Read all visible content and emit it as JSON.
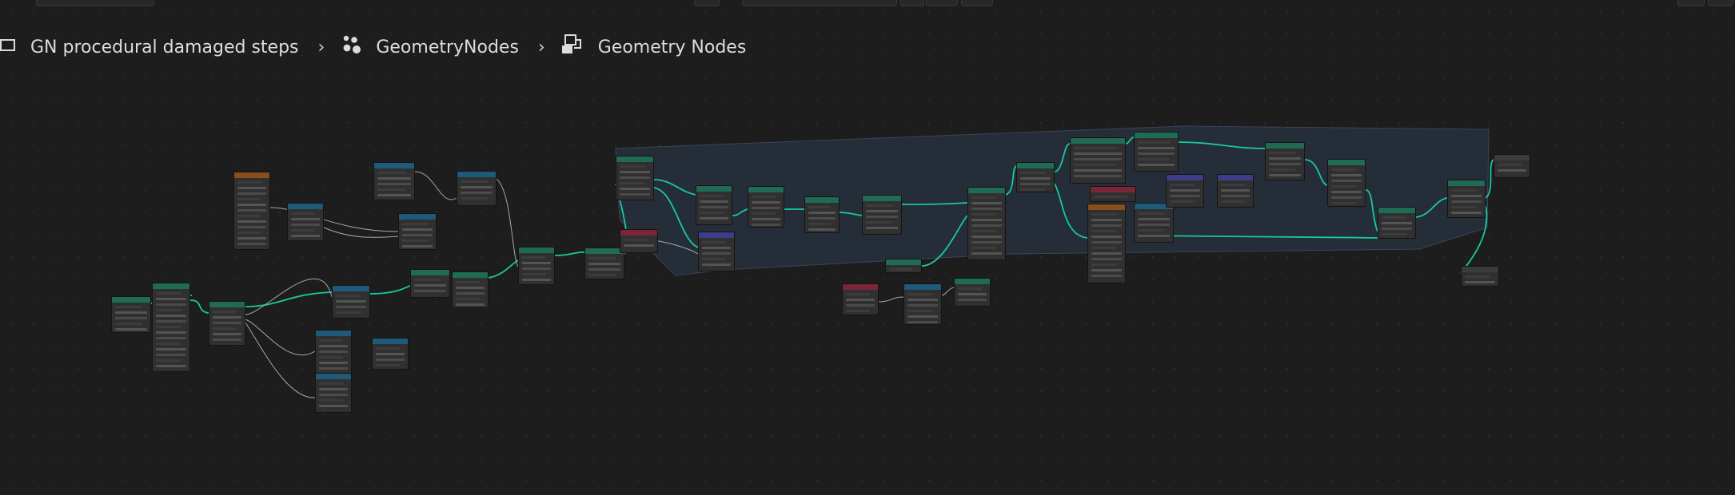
{
  "breadcrumbs": {
    "object": "GN procedural damaged steps",
    "modifier": "GeometryNodes",
    "node_group": "Geometry Nodes"
  },
  "icons": {
    "object": "object-square-icon",
    "modifier": "geometry-nodes-modifier-icon",
    "node_group": "node-tree-icon",
    "separator": "chevron-right-icon"
  },
  "colors": {
    "background": "#1d1d1d",
    "geometry_link": "#18c99e",
    "value_link": "#a8a8a8",
    "frame": "#26303d",
    "header_geometry": "#1f6b55",
    "header_input": "#8a4d1c",
    "header_converter": "#1f5a7a",
    "header_vector": "#3d3d8a",
    "header_attribute": "#7a2538",
    "header_output": "#3b3b3b"
  },
  "node_headers": [
    "geometry",
    "input",
    "converter",
    "vector",
    "attribute",
    "output"
  ]
}
